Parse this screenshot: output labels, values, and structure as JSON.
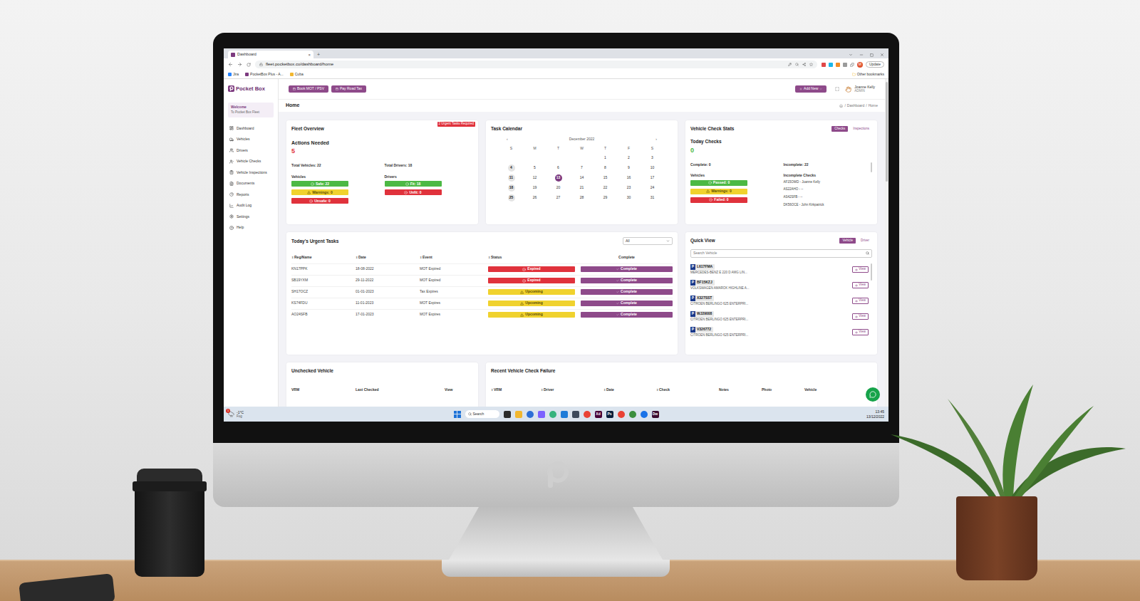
{
  "window": {
    "title": "Dashboard",
    "close": "×",
    "new_tab": "+"
  },
  "browser": {
    "url": "fleet.pocketbox.co/dashboard/home",
    "update": "Update",
    "avatar": "M",
    "bookmarks": [
      "Jira",
      "PocketBox Plus - A...",
      "Cuba"
    ],
    "other_bookmarks": "Other bookmarks"
  },
  "app": {
    "logo": "Pocket Box",
    "welcome": "Welcome",
    "welcome_sub": "To Pocket Box Fleet"
  },
  "sidebar": {
    "items": [
      {
        "label": "Dashboard",
        "selected": false
      },
      {
        "label": "Vehicles",
        "selected": false
      },
      {
        "label": "Drivers",
        "selected": false
      },
      {
        "label": "Vehicle Checks",
        "selected": false
      },
      {
        "label": "Vehicle Inspections",
        "selected": false
      },
      {
        "label": "Documents",
        "selected": false
      },
      {
        "label": "Reports",
        "selected": false
      },
      {
        "label": "Audit Log",
        "selected": false
      },
      {
        "label": "Settings",
        "selected": false
      },
      {
        "label": "Help",
        "selected": false
      }
    ]
  },
  "header": {
    "buttons": [
      "Book MOT / PSV",
      "Pay Road Tax"
    ],
    "add_new": "Add New",
    "user_name": "Joanne Kelly",
    "user_role": "ADMIN"
  },
  "page": {
    "title": "Home",
    "breadcrumb": [
      "Dashboard",
      "Home"
    ],
    "separator": "/"
  },
  "fleet_overview": {
    "title": "Fleet Overview",
    "badge": "2 Urgent Tasks Required",
    "actions_label": "Actions Needed",
    "actions_count": "5",
    "total_vehicles": "Total Vehicles: 22",
    "total_drivers": "Total Drivers: 18",
    "vehicles_label": "Vehicles",
    "drivers_label": "Drivers",
    "vehicles": [
      {
        "label": "Safe: 22",
        "kind": "ok",
        "color": "#4cb944"
      },
      {
        "label": "Warnings: 0",
        "kind": "warning",
        "color": "#f0d22e"
      },
      {
        "label": "Unsafe: 0",
        "kind": "danger",
        "color": "#e0323c"
      }
    ],
    "drivers": [
      {
        "label": "Fit: 18",
        "kind": "ok",
        "color": "#4cb944"
      },
      {
        "label": "Unfit: 0",
        "kind": "danger",
        "color": "#e0323c"
      }
    ]
  },
  "calendar": {
    "title": "Task Calendar",
    "month": "December 2022",
    "prev": "‹",
    "next": "›",
    "weekdays": [
      "S",
      "M",
      "T",
      "W",
      "T",
      "F",
      "S"
    ],
    "weeks": [
      [
        {
          "day": "",
          "selected": false,
          "highlighted": false
        },
        {
          "day": "",
          "selected": false,
          "highlighted": false
        },
        {
          "day": "",
          "selected": false,
          "highlighted": false
        },
        {
          "day": "",
          "selected": false,
          "highlighted": false
        },
        {
          "day": "1",
          "selected": false,
          "highlighted": false
        },
        {
          "day": "2",
          "selected": false,
          "highlighted": false
        },
        {
          "day": "3",
          "selected": false,
          "highlighted": false
        }
      ],
      [
        {
          "day": "4",
          "selected": false,
          "highlighted": true
        },
        {
          "day": "5",
          "selected": false,
          "highlighted": false
        },
        {
          "day": "6",
          "selected": false,
          "highlighted": false
        },
        {
          "day": "7",
          "selected": false,
          "highlighted": false
        },
        {
          "day": "8",
          "selected": false,
          "highlighted": false
        },
        {
          "day": "9",
          "selected": false,
          "highlighted": false
        },
        {
          "day": "10",
          "selected": false,
          "highlighted": false
        }
      ],
      [
        {
          "day": "11",
          "selected": false,
          "highlighted": true
        },
        {
          "day": "12",
          "selected": false,
          "highlighted": false
        },
        {
          "day": "13",
          "selected": true,
          "highlighted": false
        },
        {
          "day": "14",
          "selected": false,
          "highlighted": false
        },
        {
          "day": "15",
          "selected": false,
          "highlighted": false
        },
        {
          "day": "16",
          "selected": false,
          "highlighted": false
        },
        {
          "day": "17",
          "selected": false,
          "highlighted": false
        }
      ],
      [
        {
          "day": "18",
          "selected": false,
          "highlighted": true
        },
        {
          "day": "19",
          "selected": false,
          "highlighted": false
        },
        {
          "day": "20",
          "selected": false,
          "highlighted": false
        },
        {
          "day": "21",
          "selected": false,
          "highlighted": false
        },
        {
          "day": "22",
          "selected": false,
          "highlighted": false
        },
        {
          "day": "23",
          "selected": false,
          "highlighted": false
        },
        {
          "day": "24",
          "selected": false,
          "highlighted": false
        }
      ],
      [
        {
          "day": "25",
          "selected": false,
          "highlighted": true
        },
        {
          "day": "26",
          "selected": false,
          "highlighted": false
        },
        {
          "day": "27",
          "selected": false,
          "highlighted": false
        },
        {
          "day": "28",
          "selected": false,
          "highlighted": false
        },
        {
          "day": "29",
          "selected": false,
          "highlighted": false
        },
        {
          "day": "30",
          "selected": false,
          "highlighted": false
        },
        {
          "day": "31",
          "selected": false,
          "highlighted": false
        }
      ]
    ]
  },
  "check_stats": {
    "title": "Vehicle Check Stats",
    "tabs": [
      {
        "label": "Checks",
        "selected": true
      },
      {
        "label": "Inspections",
        "selected": false
      }
    ],
    "today_label": "Today Checks",
    "today_count": "0",
    "complete": "Complete: 0",
    "incomplete": "Incomplete: 22",
    "vehicles_label": "Vehicles",
    "vehicles": [
      {
        "label": "Passed: 0",
        "kind": "ok",
        "color": "#4cb944"
      },
      {
        "label": "Warnings: 0",
        "kind": "warning",
        "color": "#f0d22e"
      },
      {
        "label": "Failed: 0",
        "kind": "danger",
        "color": "#e0323c"
      }
    ],
    "incomplete_label": "Incomplete Checks",
    "incomplete_checks": [
      "AF15OWD - Joanne Kelly",
      "AS22AHO - --",
      "AS42SFB - --",
      "DK56OCE - John Kirkpatrick"
    ]
  },
  "urgent_tasks": {
    "title": "Today's Urgent Tasks",
    "filter": "All",
    "columns": [
      "Reg/Name",
      "Date",
      "Event",
      "Status",
      "Complete"
    ],
    "rows": [
      {
        "reg": "KN17PPK",
        "date": "18-08-2022",
        "event": "MOT Expired",
        "status": "Expired",
        "kind": "danger",
        "color": "#e0323c",
        "action": "Complete"
      },
      {
        "reg": "SB19YXM",
        "date": "29-11-2022",
        "event": "MOT Expired",
        "status": "Expired",
        "kind": "danger",
        "color": "#e0323c",
        "action": "Complete"
      },
      {
        "reg": "SH17OCZ",
        "date": "01-01-2023",
        "event": "Tax Expires",
        "status": "Upcoming",
        "kind": "warning",
        "color": "#f0d22e",
        "action": "Complete"
      },
      {
        "reg": "KS74FDU",
        "date": "11-01-2023",
        "event": "MOT Expires",
        "status": "Upcoming",
        "kind": "warning",
        "color": "#f0d22e",
        "action": "Complete"
      },
      {
        "reg": "AO24SFB",
        "date": "17-01-2023",
        "event": "MOT Expires",
        "status": "Upcoming",
        "kind": "warning",
        "color": "#f0d22e",
        "action": "Complete"
      }
    ]
  },
  "quick_view": {
    "title": "Quick View",
    "tabs": [
      {
        "label": "Vehicle",
        "selected": true
      },
      {
        "label": "Driver",
        "selected": false
      }
    ],
    "search_placeholder": "Search Vehicle",
    "plate_mark": "P",
    "view": "View",
    "vehicles": [
      {
        "reg": "L617FMA",
        "desc": "MERCEDES-BENZ E 220 D AMG LIN..."
      },
      {
        "reg": "BF15KZJ",
        "desc": "VOLKSWAGEN AMAROK HIGHLINE A..."
      },
      {
        "reg": "X327SST",
        "desc": "CITROEN BERLINGO 625 ENTERPRI..."
      },
      {
        "reg": "WJ29008",
        "desc": "CITROEN BERLINGO 625 ENTERPRI..."
      },
      {
        "reg": "V326772",
        "desc": "CITROEN BERLINGO 625 ENTERPRI..."
      }
    ]
  },
  "unchecked": {
    "title": "Unchecked Vehicle",
    "columns": [
      "VRM",
      "Last Checked",
      "View"
    ]
  },
  "recent_failures": {
    "title": "Recent Vehicle Check Failure",
    "columns": [
      "VRM",
      "Driver",
      "Date",
      "Check",
      "Notes",
      "Photo",
      "Vehicle"
    ]
  },
  "taskbar": {
    "weather_temp": "-1°C",
    "weather_desc": "Fog",
    "notification": "1",
    "search": "Search",
    "time": "13:45",
    "date": "13/12/2022",
    "apps": [
      {
        "kind": "tile",
        "color": "#2b2b2b"
      },
      {
        "kind": "tile",
        "color": "#f2b72f"
      },
      {
        "kind": "circle",
        "color": "#2d6fd6"
      },
      {
        "kind": "tile",
        "color": "#7b61ff"
      },
      {
        "kind": "circle",
        "color": "#36b37e"
      },
      {
        "kind": "tile",
        "color": "#1d7bd8"
      },
      {
        "kind": "tile",
        "color": "#3d4a5c"
      },
      {
        "kind": "circle",
        "color": "#e94235"
      },
      {
        "kind": "tile",
        "color": "#470137",
        "label": "Xd"
      },
      {
        "kind": "tile",
        "color": "#0a1f3b",
        "label": "Ps"
      },
      {
        "kind": "circle",
        "color": "#e94235"
      },
      {
        "kind": "circle",
        "color": "#3b8f3e"
      },
      {
        "kind": "circle",
        "color": "#1a73e8"
      },
      {
        "kind": "tile",
        "color": "#3a0a2f",
        "label": "Dw"
      }
    ]
  }
}
